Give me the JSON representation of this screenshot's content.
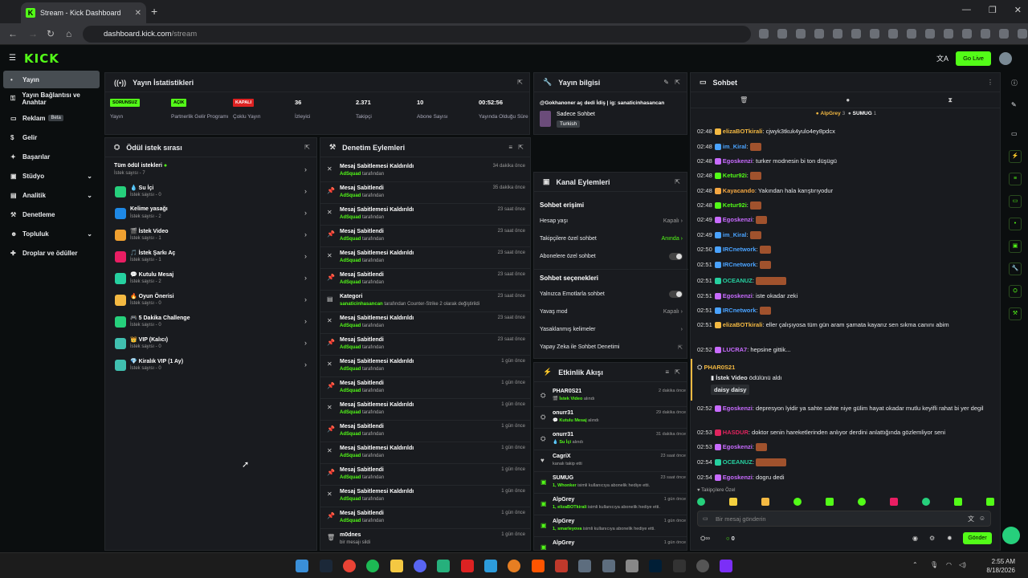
{
  "browser": {
    "tab_title": "Stream - Kick Dashboard",
    "url_domain": "dashboard.kick.com",
    "url_path": "/stream"
  },
  "app": {
    "logo": "KICK",
    "go_live": "Go Live"
  },
  "sidebar": {
    "items": [
      {
        "label": "Yayın",
        "icon": "broadcast-icon",
        "active": true
      },
      {
        "label": "Yayın Bağlantısı ve Anahtar",
        "icon": "key-icon"
      },
      {
        "label": "Reklam",
        "icon": "ad-icon",
        "beta": "Beta"
      },
      {
        "label": "Gelir",
        "icon": "money-icon"
      },
      {
        "label": "Başarılar",
        "icon": "trophy-icon"
      },
      {
        "label": "Stüdyo",
        "icon": "studio-icon",
        "expand": true
      },
      {
        "label": "Analitik",
        "icon": "chart-icon",
        "expand": true
      },
      {
        "label": "Denetleme",
        "icon": "hammer-icon"
      },
      {
        "label": "Topluluk",
        "icon": "people-icon",
        "expand": true
      },
      {
        "label": "Droplar ve ödüller",
        "icon": "gift-icon"
      }
    ]
  },
  "stats": {
    "title": "Yayın İstatistikleri",
    "items": [
      {
        "badge": "SORUNSUZ",
        "label": "Yayın"
      },
      {
        "badge": "AÇIK",
        "label": "Partnerlik Gelir Programı"
      },
      {
        "badge": "KAPALI",
        "label": "Çoklu Yayın"
      },
      {
        "value": "36",
        "label": "İzleyici"
      },
      {
        "value": "2.371",
        "label": "Takipçi"
      },
      {
        "value": "10",
        "label": "Abone Sayısı"
      },
      {
        "value": "00:52:56",
        "label": "Yayında Olduğu Süre"
      }
    ]
  },
  "stream_info": {
    "title": "Yayın bilgisi",
    "stream_title": "@Gokhanoner aç dedi İdiş | ig: sanaticinhasancan",
    "category": "Sadece Sohbet",
    "tag": "Turkish"
  },
  "rewards": {
    "title": "Ödül istek sırası",
    "all_label": "Tüm ödül istekleri",
    "all_count": "İstek sayısı - 7",
    "items": [
      {
        "name": "💧 Su İçi",
        "count": "İstek sayısı - 0",
        "color": "#26d07c"
      },
      {
        "name": "Kelime yasağı",
        "count": "İstek sayısı - 2",
        "color": "#1e88e5"
      },
      {
        "name": "🎬 İstek Video",
        "count": "İstek sayısı - 1",
        "color": "#f0a030"
      },
      {
        "name": "🎵 İstek Şarkı Aç",
        "count": "İstek sayısı - 1",
        "color": "#e91e63"
      },
      {
        "name": "💬 Kutulu Mesaj",
        "count": "İstek sayısı - 2",
        "color": "#26d0a0"
      },
      {
        "name": "🔥 Oyun Önerisi",
        "count": "İstek sayısı - 0",
        "color": "#f4b942"
      },
      {
        "name": "🎮 5 Dakika Challenge",
        "count": "İstek sayısı - 0",
        "color": "#26d07c"
      },
      {
        "name": "👑 VIP (Kalıcı)",
        "count": "İstek sayısı - 0",
        "color": "#40c0b0"
      },
      {
        "name": "💎 Kiralık VIP (1 Ay)",
        "count": "İstek sayısı - 0",
        "color": "#40c0b0"
      }
    ]
  },
  "moderation": {
    "title": "Denetim Eylemleri",
    "items": [
      {
        "icon": "unpin",
        "title": "Mesaj Sabitlemesi Kaldırıldı",
        "by": "AdSquad",
        "suffix": "tarafından",
        "time": "34 dakika önce"
      },
      {
        "icon": "pin",
        "title": "Mesaj Sabitlendi",
        "by": "AdSquad",
        "suffix": "tarafından",
        "time": "35 dakika önce"
      },
      {
        "icon": "unpin",
        "title": "Mesaj Sabitlemesi Kaldırıldı",
        "by": "AdSquad",
        "suffix": "tarafından",
        "time": "23 saat önce"
      },
      {
        "icon": "pin",
        "title": "Mesaj Sabitlendi",
        "by": "AdSquad",
        "suffix": "tarafından",
        "time": "23 saat önce"
      },
      {
        "icon": "unpin",
        "title": "Mesaj Sabitlemesi Kaldırıldı",
        "by": "AdSquad",
        "suffix": "tarafından",
        "time": "23 saat önce"
      },
      {
        "icon": "pin",
        "title": "Mesaj Sabitlendi",
        "by": "AdSquad",
        "suffix": "tarafından",
        "time": "23 saat önce"
      },
      {
        "icon": "category",
        "title": "Kategori",
        "by": "sanaticinhasancan",
        "suffix": "tarafından Counter-Strike 2 olarak değiştirildi",
        "time": "23 saat önce"
      },
      {
        "icon": "unpin",
        "title": "Mesaj Sabitlemesi Kaldırıldı",
        "by": "AdSquad",
        "suffix": "tarafından",
        "time": "23 saat önce"
      },
      {
        "icon": "pin",
        "title": "Mesaj Sabitlendi",
        "by": "AdSquad",
        "suffix": "tarafından",
        "time": "23 saat önce"
      },
      {
        "icon": "unpin",
        "title": "Mesaj Sabitlemesi Kaldırıldı",
        "by": "AdSquad",
        "suffix": "tarafından",
        "time": "1 gün önce"
      },
      {
        "icon": "pin",
        "title": "Mesaj Sabitlendi",
        "by": "AdSquad",
        "suffix": "tarafından",
        "time": "1 gün önce"
      },
      {
        "icon": "unpin",
        "title": "Mesaj Sabitlemesi Kaldırıldı",
        "by": "AdSquad",
        "suffix": "tarafından",
        "time": "1 gün önce"
      },
      {
        "icon": "pin",
        "title": "Mesaj Sabitlendi",
        "by": "AdSquad",
        "suffix": "tarafından",
        "time": "1 gün önce"
      },
      {
        "icon": "unpin",
        "title": "Mesaj Sabitlemesi Kaldırıldı",
        "by": "AdSquad",
        "suffix": "tarafından",
        "time": "1 gün önce"
      },
      {
        "icon": "pin",
        "title": "Mesaj Sabitlendi",
        "by": "AdSquad",
        "suffix": "tarafından",
        "time": "1 gün önce"
      },
      {
        "icon": "unpin",
        "title": "Mesaj Sabitlemesi Kaldırıldı",
        "by": "AdSquad",
        "suffix": "tarafından",
        "time": "1 gün önce"
      },
      {
        "icon": "pin",
        "title": "Mesaj Sabitlendi",
        "by": "AdSquad",
        "suffix": "tarafından",
        "time": "1 gün önce"
      },
      {
        "icon": "delete",
        "title": "m0dnes",
        "by": "",
        "suffix": "bir mesajı sildi",
        "time": "1 gün önce"
      }
    ]
  },
  "channel_actions": {
    "title": "Kanal Eylemleri",
    "chat_access": "Sohbet erişimi",
    "rows1": [
      {
        "label": "Hesap yaşı",
        "value": "Kapalı",
        "type": "chev"
      },
      {
        "label": "Takipçilere özel sohbet",
        "value": "Anında",
        "type": "chev",
        "green": true
      },
      {
        "label": "Abonelere özel sohbet",
        "type": "toggle"
      }
    ],
    "chat_options": "Sohbet seçenekleri",
    "rows2": [
      {
        "label": "Yalnızca Emotlarla sohbet",
        "type": "toggle"
      },
      {
        "label": "Yavaş mod",
        "value": "Kapalı",
        "type": "chev"
      },
      {
        "label": "Yasaklanmış kelimeler",
        "type": "chev"
      },
      {
        "label": "Yapay Zeka ile Sohbet Denetimi",
        "type": "ext"
      }
    ]
  },
  "activity": {
    "title": "Etkinlik Akışı",
    "items": [
      {
        "name": "PHAR0S21",
        "sub_b": "🎬 İstek Video",
        "sub": "alındı",
        "time": "2 dakika önce",
        "icon": "reward"
      },
      {
        "name": "onurr31",
        "sub_b": "💬 Kutulu Mesaj",
        "sub": "alındı",
        "time": "29 dakika önce",
        "icon": "reward"
      },
      {
        "name": "onurr31",
        "sub_b": "💧 Su İçi",
        "sub": "alındı",
        "time": "31 dakika önce",
        "icon": "reward"
      },
      {
        "name": "CagriX",
        "sub_b": "",
        "sub": "kanalı takip etti",
        "time": "23 saat önce",
        "icon": "heart"
      },
      {
        "name": "SUMUG",
        "sub_b": "1, Whonker",
        "sub": "isimli kullanıcıya abonelik hediye etti.",
        "time": "23 saat önce",
        "icon": "gift"
      },
      {
        "name": "AlpGrey",
        "sub_b": "1, elizaBOTkirali",
        "sub": "isimli kullanıcıya abonelik hediye etti.",
        "time": "1 gün önce",
        "icon": "gift"
      },
      {
        "name": "AlpGrey",
        "sub_b": "1, smarleyova",
        "sub": "isimli kullanıcıya abonelik hediye etti.",
        "time": "1 gün önce",
        "icon": "gift"
      },
      {
        "name": "AlpGrey",
        "sub_b": "",
        "sub": "",
        "time": "1 gün önce",
        "icon": "gift"
      }
    ]
  },
  "chat": {
    "title": "Sohbet",
    "top_gifters": [
      {
        "name": "AlpGrey",
        "count": "3"
      },
      {
        "name": "SUMUG",
        "count": "1"
      }
    ],
    "messages": [
      {
        "time": "02:48",
        "user": "elizaBOTkirali",
        "color": "#f4b942",
        "text": "cjwyk3tkuk4yulo4ey8pdcx"
      },
      {
        "time": "02:48",
        "user": "im_Kiral",
        "color": "#4aa3ff",
        "text": "",
        "emote": true
      },
      {
        "time": "02:48",
        "user": "Egoskenzi",
        "color": "#c86bff",
        "text": "turker modnesin bi ton düşügü"
      },
      {
        "time": "02:48",
        "user": "Ketur92i",
        "color": "#53fc18",
        "text": "",
        "emote": true
      },
      {
        "time": "02:48",
        "user": "Kayacando",
        "color": "#f4a742",
        "text": "Yakından hala karıştırıyodur"
      },
      {
        "time": "02:48",
        "user": "Ketur92i",
        "color": "#53fc18",
        "text": "",
        "emote": true
      },
      {
        "time": "02:49",
        "user": "Egoskenzi",
        "color": "#c86bff",
        "text": "",
        "emote": true
      },
      {
        "time": "02:49",
        "user": "im_Kiral",
        "color": "#4aa3ff",
        "text": "",
        "emote": true
      },
      {
        "time": "02:50",
        "user": "IRCnetwork",
        "color": "#4aa3ff",
        "text": "",
        "emote": true
      },
      {
        "time": "02:51",
        "user": "IRCnetwork",
        "color": "#4aa3ff",
        "text": "",
        "emote": true
      },
      {
        "time": "02:51",
        "user": "OCEANUZ",
        "color": "#26d0a0",
        "text": "",
        "emote": true,
        "wide": true
      },
      {
        "time": "02:51",
        "user": "Egoskenzi",
        "color": "#c86bff",
        "text": "iste okadar zeki"
      },
      {
        "time": "02:51",
        "user": "IRCnetwork",
        "color": "#4aa3ff",
        "text": "",
        "emote": true
      },
      {
        "time": "02:51",
        "user": "elizaBOTkirali",
        "color": "#f4b942",
        "text": "eller çalışıyosa tüm gün aram şamata kayarız sen sıkma canını abim"
      },
      {
        "time": "02:52",
        "user": "LUCRA7",
        "color": "#c86bff",
        "text": "hepsine gittik..."
      }
    ],
    "reward_event": {
      "user": "PHAR0S21",
      "reward": "İstek Video",
      "suffix": "ödülünü aldı",
      "message": "daisy daisy"
    },
    "messages2": [
      {
        "time": "02:52",
        "user": "Egoskenzi",
        "color": "#c86bff",
        "text": "depresyon lyidir ya sahte sahte niye gülim hayat okadar mutlu keyifli rahat bi yer degil"
      },
      {
        "time": "02:53",
        "user": "HASDUR",
        "color": "#e0245e",
        "text": "doktor senin hareketlerinden anlıyor derdini anlattığında gözlemliyor seni"
      },
      {
        "time": "02:53",
        "user": "Egoskenzi",
        "color": "#c86bff",
        "text": "",
        "emote": true
      },
      {
        "time": "02:54",
        "user": "OCEANUZ",
        "color": "#26d0a0",
        "text": "",
        "emote": true,
        "wide": true
      },
      {
        "time": "02:54",
        "user": "Egoskenzi",
        "color": "#c86bff",
        "text": "dogru dedi"
      }
    ],
    "followers_only": "Takipçilere Özel",
    "input_placeholder": "Bir mesaj gönderin",
    "points": "0",
    "send": "Gönder"
  },
  "taskbar": {
    "time": "2:55 AM",
    "date": "8/18/2026"
  }
}
